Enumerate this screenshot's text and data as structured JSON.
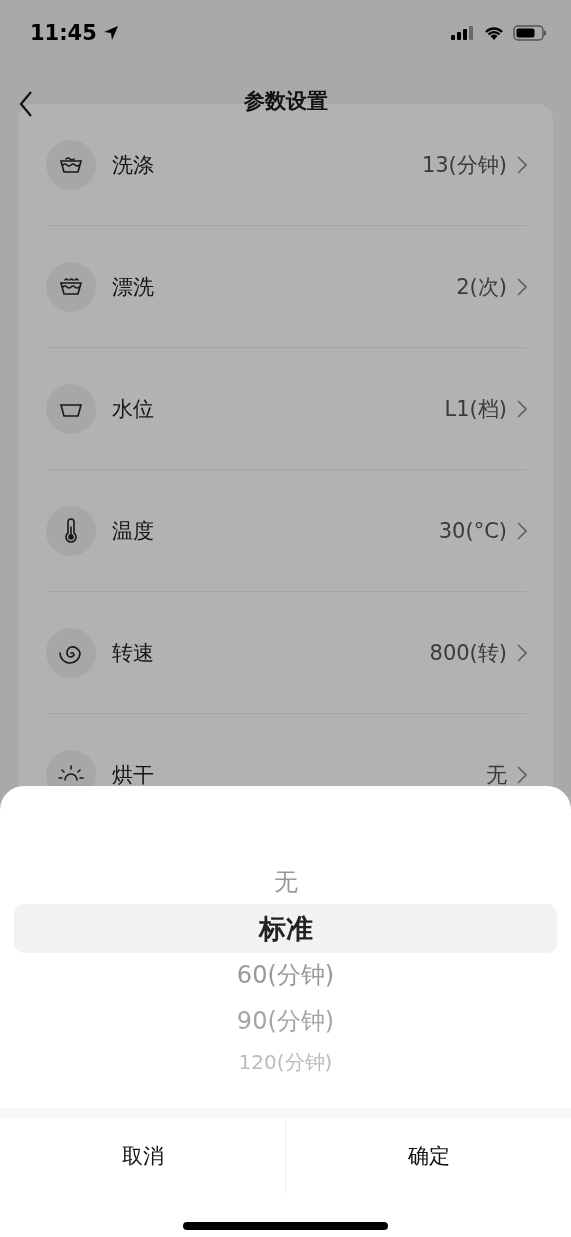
{
  "status_bar": {
    "time": "11:45"
  },
  "nav": {
    "title": "参数设置"
  },
  "settings": [
    {
      "label": "洗涤",
      "value": "13(分钟)"
    },
    {
      "label": "漂洗",
      "value": "2(次)"
    },
    {
      "label": "水位",
      "value": "L1(档)"
    },
    {
      "label": "温度",
      "value": "30(°C)"
    },
    {
      "label": "转速",
      "value": "800(转)"
    },
    {
      "label": "烘干",
      "value": "无"
    }
  ],
  "picker": {
    "options": [
      {
        "label": "无",
        "selected": false
      },
      {
        "label": "标准",
        "selected": true
      },
      {
        "label": "60(分钟)",
        "selected": false
      },
      {
        "label": "90(分钟)",
        "selected": false
      },
      {
        "label": "120(分钟)",
        "selected": false
      }
    ]
  },
  "buttons": {
    "cancel": "取消",
    "confirm": "确定"
  }
}
